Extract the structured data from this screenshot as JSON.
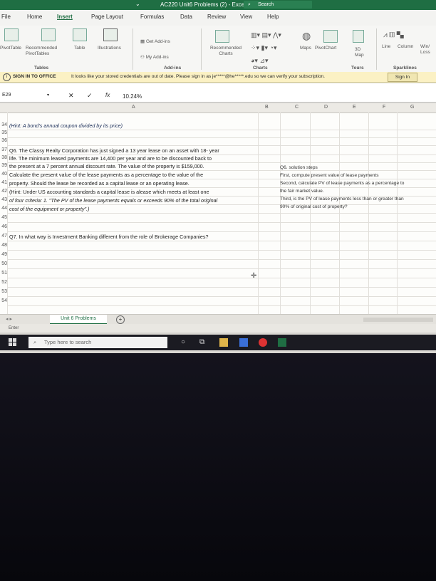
{
  "titlebar": {
    "title": "AC220 Unit6 Problems (2)  -  Excel",
    "search": "Search",
    "brand_color": "#1f6e43"
  },
  "tabs": [
    "File",
    "Home",
    "Insert",
    "Page Layout",
    "Formulas",
    "Data",
    "Review",
    "View",
    "Help"
  ],
  "ribbon": {
    "pivottable": "PivotTable",
    "recommended_pivottables": "Recommended PivotTables",
    "table": "Table",
    "illustrations": "Illustrations",
    "get_addins": "Get Add-ins",
    "my_addins": "My Add-ins",
    "recommended_charts": "Recommended Charts",
    "maps": "Maps",
    "pivotchart": "PivotChart",
    "map3d": "3D Map",
    "line": "Line",
    "column": "Column",
    "winloss": "Win/ Loss",
    "group_tables": "Tables",
    "group_addins": "Add-ins",
    "group_charts": "Charts",
    "group_tours": "Tours",
    "group_sparklines": "Sparklines"
  },
  "message_bar": {
    "title": "SIGN IN TO OFFICE",
    "text": "It looks like your stored credentials are out of date. Please sign in as je*****@he*****.edu so we can verify your subscription.",
    "button": "Sign In"
  },
  "formula_bar": {
    "name_box": "E29",
    "cancel": "✕",
    "enter": "✓",
    "fx": "fx",
    "value": "10.24%"
  },
  "columns": [
    "A",
    "B",
    "C",
    "D",
    "E",
    "F",
    "G"
  ],
  "rows": {
    "r34": {
      "num": "34",
      "text": "(Hint: A bond's annual coupon divided by its price)"
    },
    "r35": {
      "num": "35",
      "text": ""
    },
    "r36": {
      "num": "36",
      "text": ""
    },
    "r37": {
      "num": "37",
      "text": "Q6. The Classy Realty Corporation has just signed a 13 year lease on an asset with 18- year"
    },
    "r38": {
      "num": "38",
      "text": "life. The minimum leased payments are 14,400 per year and are to be discounted back to"
    },
    "r39": {
      "num": "39",
      "text": "the present at a 7 percent annual discount rate. The value of the property is $159,000."
    },
    "r40": {
      "num": "40",
      "text": "Calculate the present value of the lease payments as a percentage to the value of the"
    },
    "r41": {
      "num": "41",
      "text": "property. Should the lease be recorded as a capital lease or an operating lease."
    },
    "r42": {
      "num": "42",
      "text": "(Hint: Under US accounting standards a capital lease is alease which meets at least one"
    },
    "r43": {
      "num": "43",
      "text": "of four criteria: 1. \"The PV of the lease payments equals or exceeds 90% of the total original"
    },
    "r44": {
      "num": "44",
      "text": "cost of the equipment or property\".)"
    },
    "r45": {
      "num": "45",
      "text": ""
    },
    "r46": {
      "num": "46",
      "text": ""
    },
    "r47": {
      "num": "47",
      "text": "Q7. In what way is Investment Banking different from the role of Brokerage Companies?"
    },
    "r48": {
      "num": "48",
      "text": ""
    },
    "r49": {
      "num": "49",
      "text": ""
    },
    "r50": {
      "num": "50",
      "text": ""
    },
    "r51": {
      "num": "51",
      "text": ""
    },
    "r52": {
      "num": "52",
      "text": ""
    },
    "r53": {
      "num": "53",
      "text": ""
    },
    "r54": {
      "num": "54",
      "text": ""
    }
  },
  "solution_steps": [
    "Q6. solution steps",
    "First, compute present value of lease payments",
    "Second, calculate PV of lease payments as a percentage to",
    "the fair market value.",
    "Third, is the PV of lease payments less than or greater than",
    "90% of original cost of property?"
  ],
  "sheet_tab": "Unit 6 Problems",
  "status": "Enter",
  "taskbar": {
    "search_placeholder": "Type here to search"
  }
}
